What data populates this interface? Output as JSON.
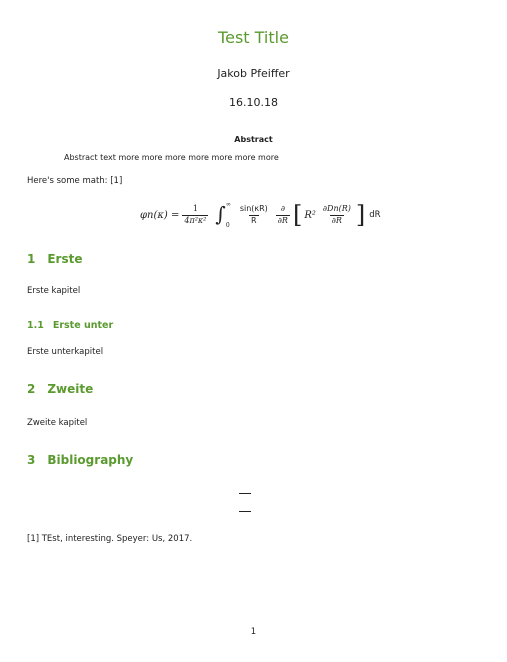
{
  "document": {
    "title": "Test Title",
    "author": "Jakob Pfeiffer",
    "date": "16.10.18",
    "abstract_heading": "Abstract",
    "abstract_text": "Abstract text more more more more more more more",
    "intro_text": "Here's some math: [1]",
    "equation": {
      "lhs": "φn(κ) =",
      "frac1_num": "1",
      "frac1_den": "4π²κ²",
      "integral_upper": "∞",
      "integral_lower": "0",
      "frac2_num": "sin(κR)",
      "frac2_den": "R",
      "frac3_num": "∂",
      "frac3_den": "∂R",
      "r_squared": "R²",
      "frac4_num": "∂Dn(R)",
      "frac4_den": "∂R",
      "differential": "dR"
    },
    "sections": [
      {
        "number": "1",
        "title": "Erste",
        "text": "Erste kapitel"
      },
      {
        "number": "2",
        "title": "Zweite",
        "text": "Zweite kapitel"
      },
      {
        "number": "3",
        "title": "Bibliography",
        "text": ""
      }
    ],
    "subsections": [
      {
        "number": "1.1",
        "title": "Erste unter",
        "text": "Erste unterkapitel"
      }
    ],
    "bibliography_entry": "[1] TEst, interesting. Speyer: Us, 2017.",
    "page_number": "1"
  }
}
